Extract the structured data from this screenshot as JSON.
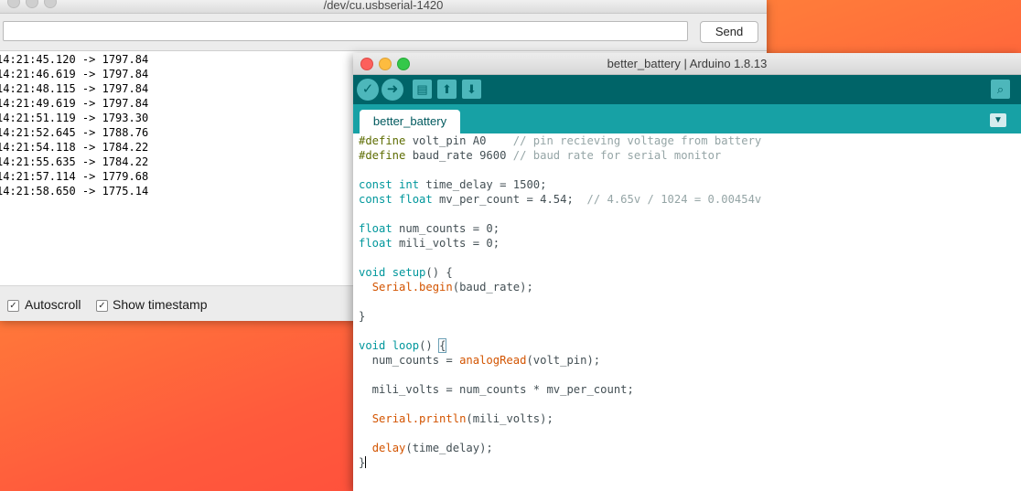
{
  "serial_monitor": {
    "title": "/dev/cu.usbserial-1420",
    "input_value": "",
    "send_label": "Send",
    "lines": [
      "14:21:45.120 -> 1797.84",
      "14:21:46.619 -> 1797.84",
      "14:21:48.115 -> 1797.84",
      "14:21:49.619 -> 1797.84",
      "14:21:51.119 -> 1793.30",
      "14:21:52.645 -> 1788.76",
      "14:21:54.118 -> 1784.22",
      "14:21:55.635 -> 1784.22",
      "14:21:57.114 -> 1779.68",
      "14:21:58.650 -> 1775.14"
    ],
    "autoscroll_label": "Autoscroll",
    "autoscroll_checked": true,
    "timestamp_label": "Show timestamp",
    "timestamp_checked": true
  },
  "ide": {
    "title": "better_battery | Arduino 1.8.13",
    "tab_label": "better_battery",
    "toolbar_icons": [
      "verify-icon",
      "upload-icon",
      "new-icon",
      "open-icon",
      "save-icon",
      "serial-monitor-icon"
    ],
    "code": {
      "define1_directive": "#define",
      "define1_rest": " volt_pin A0    ",
      "define1_comment": "// pin recieving voltage from battery",
      "define2_directive": "#define",
      "define2_rest": " baud_rate 9600 ",
      "define2_comment": "// baud rate for serial monitor",
      "l4_kw": "const int",
      "l4_rest": " time_delay = 1500;",
      "l5_kw": "const float",
      "l5_rest": " mv_per_count = 4.54;  ",
      "l5_comment": "// 4.65v / 1024 = 0.00454v",
      "l7_kw": "float",
      "l7_rest": " num_counts = 0;",
      "l8_kw": "float",
      "l8_rest": " mili_volts = 0;",
      "l10_kw": "void",
      "l10_fn": "setup",
      "l10_rest": "() {",
      "l11_fn": "Serial.begin",
      "l11_rest": "(baud_rate);",
      "l13": "}",
      "l15_kw": "void",
      "l15_fn": "loop",
      "l15_rest": "() ",
      "l15_brace": "{",
      "l16_pre": "  num_counts = ",
      "l16_fn": "analogRead",
      "l16_rest": "(volt_pin);",
      "l18": "  mili_volts = num_counts * mv_per_count;",
      "l20_fn": "Serial.println",
      "l20_rest": "(mili_volts);",
      "l22_fn": "delay",
      "l22_rest": "(time_delay);",
      "l23": "}"
    }
  }
}
